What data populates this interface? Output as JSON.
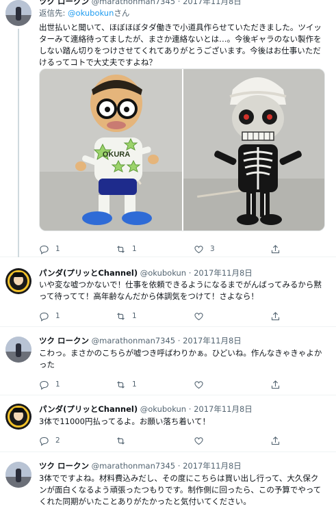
{
  "tweets": [
    {
      "name": "ツク ロークン",
      "handle": "@marathonman7345",
      "date": "2017年11月8日",
      "reply_prefix": "返信先: ",
      "reply_handle": "@okubokun",
      "reply_suffix": "さん",
      "text": "出世払いと聞いて、ほぼほぼタダ働きで小道具作らせていただきました。ツイッターみて連絡待ってましたが、まさか連絡ないとは…。今後ギャラのない製作をしない踏ん切りをつけさせてくれてありがとうございます。今後はお仕事いただけるってコトで大丈夫ですよね？",
      "reply_count": "1",
      "retweet_count": "1",
      "like_count": "3"
    },
    {
      "name": "パンダ(プリッとChannel)",
      "handle": "@okubokun",
      "date": "2017年11月8日",
      "text": "いや変な嘘つかないで！仕事を依頼できるようになるまでがんばってみるから黙って待ってて！高年齢なんだから体調気をつけて！さよなら！",
      "reply_count": "1",
      "retweet_count": "1",
      "like_count": ""
    },
    {
      "name": "ツク ロークン",
      "handle": "@marathonman7345",
      "date": "2017年11月8日",
      "text": "こわっ。まさかのこちらが嘘つき呼ばわりかぁ。ひどいね。作んなきゃきゃよかった",
      "reply_count": "1",
      "retweet_count": "1",
      "like_count": ""
    },
    {
      "name": "パンダ(プリッとChannel)",
      "handle": "@okubokun",
      "date": "2017年11月8日",
      "text": "3体で11000円払ってるよ。お願い落ち着いて！",
      "reply_count": "2",
      "retweet_count": "",
      "like_count": ""
    },
    {
      "name": "ツク ロークン",
      "handle": "@marathonman7345",
      "date": "2017年11月8日",
      "text": "3体でですよね。材料費込みだし、その度にこちらは買い出し行って、大久保クンが面白くなるよう頑張ったつもりです。制作側に回ったら、この予算でやってくれた同期がいたことありがたかったと気付いてください。"
    }
  ],
  "icons": {
    "reply": "reply-icon",
    "retweet": "retweet-icon",
    "like": "like-icon",
    "share": "share-icon"
  },
  "media": {
    "left_photo": "puppet-with-glasses",
    "right_photo": "skeleton-puppet",
    "left_shirt_text": "OKURA"
  },
  "colors": {
    "link": "#1d9bf0",
    "secondary_text": "#536471",
    "thread_line": "#cfd9de"
  }
}
